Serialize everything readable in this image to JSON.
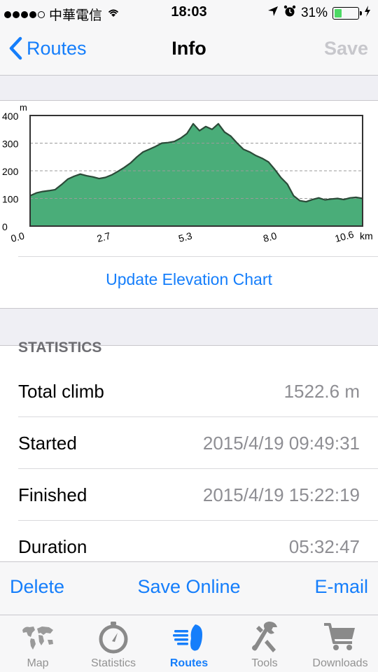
{
  "status_bar": {
    "carrier": "中華電信",
    "time": "18:03",
    "battery_text": "31%",
    "battery_level": 0.31
  },
  "nav": {
    "back_label": "Routes",
    "title": "Info",
    "save_label": "Save"
  },
  "chart_data": {
    "type": "area",
    "y_unit_label": "m",
    "x_unit_label": "km",
    "xlim": [
      0,
      10.6
    ],
    "ylim": [
      0,
      400
    ],
    "y_ticks": [
      "0",
      "100",
      "200",
      "300",
      "400"
    ],
    "x_ticks": [
      "0.0",
      "2.7",
      "5.3",
      "8.0",
      "10.6"
    ],
    "grid": true,
    "fill_color": "#4aad79",
    "line_color": "#2b4a38",
    "x": [
      0.0,
      0.2,
      0.4,
      0.6,
      0.8,
      1.0,
      1.2,
      1.4,
      1.6,
      1.8,
      2.0,
      2.2,
      2.4,
      2.6,
      2.8,
      3.0,
      3.2,
      3.4,
      3.6,
      3.8,
      4.0,
      4.2,
      4.4,
      4.6,
      4.8,
      5.0,
      5.2,
      5.4,
      5.6,
      5.8,
      6.0,
      6.2,
      6.4,
      6.6,
      6.8,
      7.0,
      7.2,
      7.4,
      7.6,
      7.8,
      8.0,
      8.2,
      8.4,
      8.6,
      8.8,
      9.0,
      9.2,
      9.4,
      9.6,
      9.8,
      10.0,
      10.2,
      10.4,
      10.6
    ],
    "y": [
      110,
      120,
      125,
      128,
      132,
      150,
      170,
      180,
      188,
      182,
      178,
      172,
      176,
      185,
      198,
      212,
      228,
      250,
      268,
      278,
      288,
      300,
      302,
      306,
      318,
      335,
      370,
      345,
      360,
      350,
      370,
      340,
      325,
      300,
      278,
      268,
      255,
      245,
      232,
      205,
      175,
      152,
      110,
      92,
      88,
      96,
      102,
      95,
      98,
      100,
      96,
      102,
      104,
      100
    ]
  },
  "chart_button": "Update Elevation Chart",
  "statistics": {
    "header": "STATISTICS",
    "rows": [
      {
        "label": "Total climb",
        "value": "1522.6 m"
      },
      {
        "label": "Started",
        "value": "2015/4/19 09:49:31"
      },
      {
        "label": "Finished",
        "value": "2015/4/19 15:22:19"
      },
      {
        "label": "Duration",
        "value": "05:32:47"
      }
    ]
  },
  "toolbar": {
    "delete_label": "Delete",
    "save_online_label": "Save Online",
    "email_label": "E-mail"
  },
  "tabs": [
    {
      "label": "Map",
      "icon": "world-map-icon",
      "active": false
    },
    {
      "label": "Statistics",
      "icon": "stopwatch-icon",
      "active": false
    },
    {
      "label": "Routes",
      "icon": "footprint-icon",
      "active": true
    },
    {
      "label": "Tools",
      "icon": "tools-icon",
      "active": false
    },
    {
      "label": "Downloads",
      "icon": "cart-icon",
      "active": false
    }
  ],
  "colors": {
    "accent": "#157efb",
    "disabled": "#c7c7cc",
    "value_gray": "#8e8e93"
  }
}
